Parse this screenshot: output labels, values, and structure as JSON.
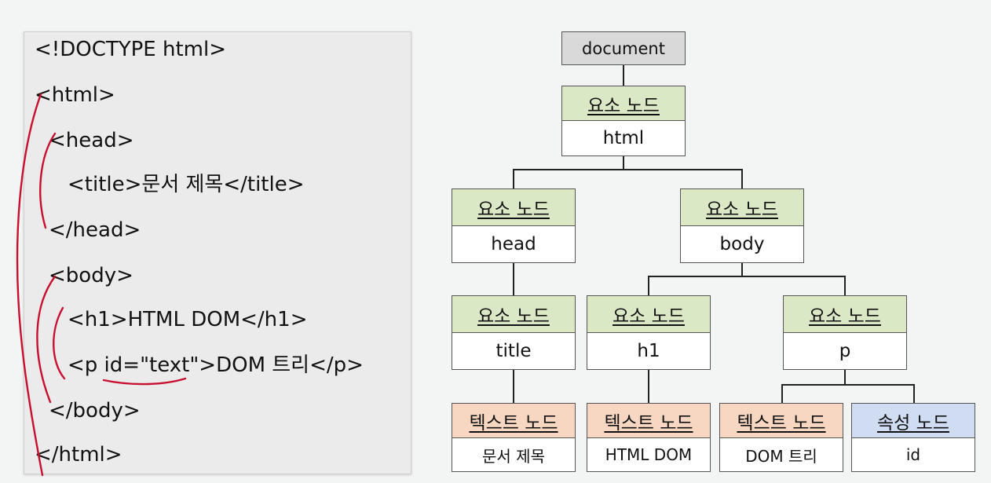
{
  "code": {
    "doctype": "<!DOCTYPE html>",
    "html_open": "<html>",
    "head_open": "<head>",
    "title_line": "<title>문서 제목</title>",
    "head_close": "</head>",
    "body_open": "<body>",
    "h1_line": "<h1>HTML DOM</h1>",
    "p_line": "<p id=\"text\">DOM 트리</p>",
    "body_close": "</body>",
    "html_close": "</html>"
  },
  "tree": {
    "document": "document",
    "element_label": "요소 노드",
    "text_label": "텍스트 노드",
    "attr_label": "속성 노드",
    "html": "html",
    "head": "head",
    "body": "body",
    "title": "title",
    "h1": "h1",
    "p": "p",
    "text_title": "문서 제목",
    "text_h1": "HTML DOM",
    "text_p": "DOM 트리",
    "attr_id": "id"
  },
  "colors": {
    "element_header": "#dbe8c6",
    "text_header": "#f7d7c2",
    "attribute_header": "#cfdcf2",
    "document_box": "#d9d9d9",
    "annotation": "#c8102e"
  }
}
